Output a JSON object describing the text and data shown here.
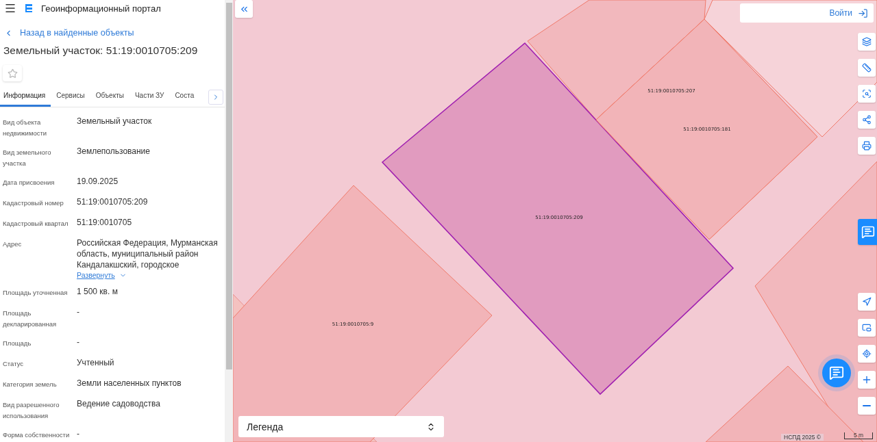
{
  "header": {
    "title": "Геоинформационный портал"
  },
  "back_link": "Назад в найденные объекты",
  "object_title": "Земельный участок: 51:19:0010705:209",
  "favorite": {
    "on": false
  },
  "tabs": [
    {
      "label": "Информация",
      "selected": true
    },
    {
      "label": "Сервисы",
      "selected": false
    },
    {
      "label": "Объекты",
      "selected": false
    },
    {
      "label": "Части ЗУ",
      "selected": false
    },
    {
      "label": "Соста",
      "selected": false
    }
  ],
  "properties": [
    {
      "label": "Вид объекта недвижимости",
      "value": "Земельный участок"
    },
    {
      "label": "Вид земельного участка",
      "value": "Землепользование"
    },
    {
      "label": "Дата присвоения",
      "value": "19.09.2025"
    },
    {
      "label": "Кадастровый номер",
      "value": "51:19:0010705:209"
    },
    {
      "label": "Кадастровый квартал",
      "value": "51:19:0010705"
    },
    {
      "label": "Адрес",
      "value": "Российская Федерация, Мурманская область, муниципальный район Кандалакшский, городское",
      "expand_label": "Развернуть"
    },
    {
      "label": "Площадь уточненная",
      "value": "1 500 кв. м"
    },
    {
      "label": "Площадь декларированная",
      "value": "-"
    },
    {
      "label": "Площадь",
      "value": "-"
    },
    {
      "label": "Статус",
      "value": "Учтенный"
    },
    {
      "label": "Категория земель",
      "value": "Земли населенных пунктов"
    },
    {
      "label": "Вид разрешенного использования",
      "value": "Ведение садоводства"
    },
    {
      "label": "Форма собственности",
      "value": "-"
    }
  ],
  "map": {
    "login_label": "Войти",
    "parcels": [
      {
        "kind": "selected",
        "label": "51:19:0010705:209"
      },
      {
        "kind": "parcel",
        "label": "51:19:0010705:207"
      },
      {
        "kind": "parcel",
        "label": "51:19:0010705:181"
      },
      {
        "kind": "parcel",
        "label": "51:19:0010705:9"
      }
    ],
    "legend_label": "Легенда",
    "attribution": "НСПД 2025 ©",
    "scale_label": "5 m"
  }
}
